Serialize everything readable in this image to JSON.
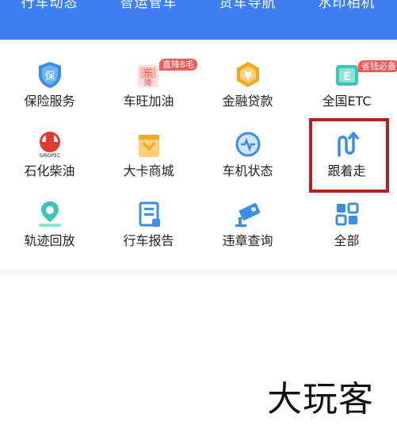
{
  "top_tabs": [
    "行车动态",
    "智运管车",
    "货车导航",
    "水印相机"
  ],
  "services": [
    {
      "label": "保险服务",
      "icon": "shield-insurance-icon"
    },
    {
      "label": "车旺加油",
      "icon": "fuel-icon",
      "badge": "直降8毛"
    },
    {
      "label": "金融贷款",
      "icon": "yuan-coin-icon"
    },
    {
      "label": "全国ETC",
      "icon": "etc-card-icon",
      "badge": "省钱必备"
    },
    {
      "label": "石化柴油",
      "icon": "sinopec-logo-icon"
    },
    {
      "label": "大卡商城",
      "icon": "store-icon"
    },
    {
      "label": "车机状态",
      "icon": "device-status-icon"
    },
    {
      "label": "跟着走",
      "icon": "follow-route-icon"
    },
    {
      "label": "轨迹回放",
      "icon": "track-playback-icon"
    },
    {
      "label": "行车报告",
      "icon": "report-icon"
    },
    {
      "label": "违章查询",
      "icon": "camera-violation-icon"
    },
    {
      "label": "全部",
      "icon": "grid-all-icon"
    }
  ],
  "logo_text": {
    "fuel_icon_char": "乐",
    "fuel_icon_extra": "降",
    "etc_char": "E",
    "yuan": "¥",
    "insurance_char": "保",
    "sinopec": "SINOPEC"
  },
  "watermark": "大玩客",
  "colors": {
    "topbar": "#3d7ef4",
    "icon_blue": "#3a8ee6",
    "icon_orange": "#f5a623",
    "highlight": "#b3221e",
    "badge": "#f25a5a"
  }
}
